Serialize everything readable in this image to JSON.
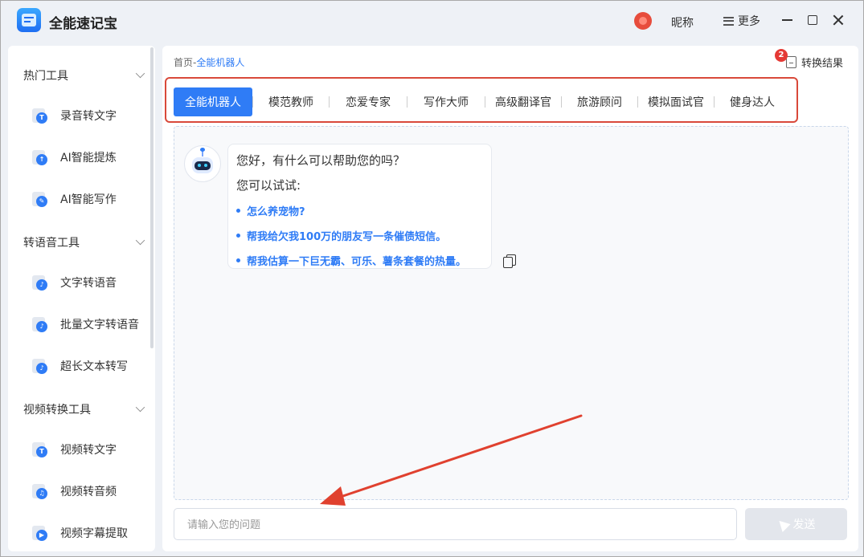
{
  "app": {
    "title": "全能速记宝"
  },
  "header": {
    "user_name": "昵称",
    "more_label": "更多"
  },
  "sidebar": {
    "sections": [
      {
        "title": "热门工具",
        "items": [
          {
            "label": "录音转文字",
            "icon": "T"
          },
          {
            "label": "AI智能提炼",
            "icon": "↑"
          },
          {
            "label": "AI智能写作",
            "icon": "✎"
          }
        ]
      },
      {
        "title": "转语音工具",
        "items": [
          {
            "label": "文字转语音",
            "icon": "♪"
          },
          {
            "label": "批量文字转语音",
            "icon": "♪"
          },
          {
            "label": "超长文本转写",
            "icon": "♪"
          }
        ]
      },
      {
        "title": "视频转换工具",
        "items": [
          {
            "label": "视频转文字",
            "icon": "T"
          },
          {
            "label": "视频转音频",
            "icon": "♫"
          },
          {
            "label": "视频字幕提取",
            "icon": "▶"
          }
        ]
      }
    ]
  },
  "main": {
    "breadcrumb": {
      "home": "首页",
      "separator": "-",
      "current": "全能机器人"
    },
    "results": {
      "label": "转换结果",
      "badge_count": "2"
    },
    "tabs": [
      {
        "label": "全能机器人",
        "active": true
      },
      {
        "label": "模范教师",
        "active": false
      },
      {
        "label": "恋爱专家",
        "active": false
      },
      {
        "label": "写作大师",
        "active": false
      },
      {
        "label": "高级翻译官",
        "active": false
      },
      {
        "label": "旅游顾问",
        "active": false
      },
      {
        "label": "模拟面试官",
        "active": false
      },
      {
        "label": "健身达人",
        "active": false
      }
    ],
    "chat": {
      "greeting": "您好，有什么可以帮助您的吗？",
      "try_label": "您可以试试:",
      "suggestions": [
        "怎么养宠物?",
        "帮我给欠我100万的朋友写一条催债短信。",
        "帮我估算一下巨无霸、可乐、薯条套餐的热量。"
      ]
    },
    "input": {
      "placeholder": "请输入您的问题",
      "value": ""
    },
    "send_label": "发送"
  },
  "colors": {
    "accent": "#2f7cf6",
    "highlight_outline": "#d9493a",
    "annotation_arrow": "#e0412f"
  }
}
